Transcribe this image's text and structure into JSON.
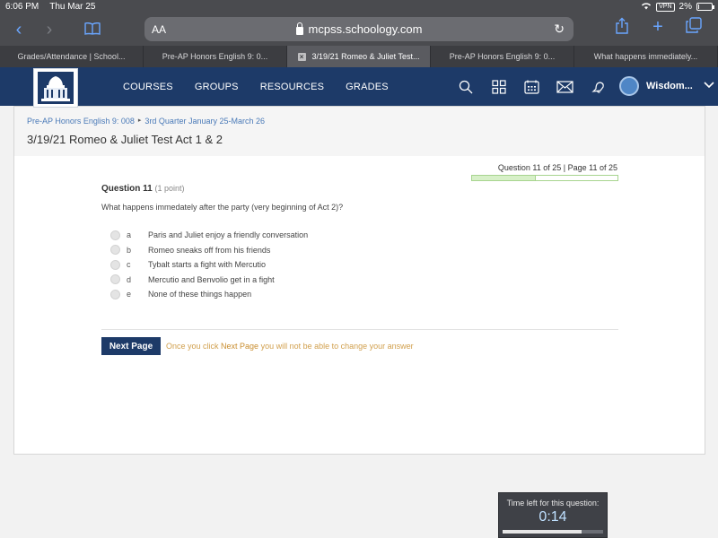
{
  "status": {
    "time": "6:06 PM",
    "date": "Thu Mar 25",
    "vpn": "VPN",
    "battery": "2%",
    "battery_level": 0.02
  },
  "browser": {
    "aa_label": "AA",
    "url": "mcpss.schoology.com",
    "tabs": [
      {
        "label": "Grades/Attendance | School...",
        "active": false
      },
      {
        "label": "Pre-AP Honors English 9: 0...",
        "active": false
      },
      {
        "label": "3/19/21 Romeo & Juliet Test...",
        "active": true
      },
      {
        "label": "Pre-AP Honors English 9: 0...",
        "active": false
      },
      {
        "label": "What happens immediately...",
        "active": false
      }
    ]
  },
  "header": {
    "nav": [
      "COURSES",
      "GROUPS",
      "RESOURCES",
      "GRADES"
    ],
    "user_name": "Wisdom..."
  },
  "breadcrumb": {
    "course": "Pre-AP Honors English 9: 008",
    "separator": "▸",
    "section": "3rd Quarter January 25-March 26"
  },
  "page_title": "3/19/21 Romeo & Juliet Test Act 1 & 2",
  "progress": {
    "label": "Question 11 of 25 | Page 11 of 25",
    "fraction": 0.44
  },
  "question": {
    "title": "Question 11",
    "points": "(1 point)",
    "text": "What happens immedately after the party (very beginning of Act 2)?",
    "choices": [
      {
        "letter": "a",
        "text": "Paris and Juliet enjoy a friendly conversation"
      },
      {
        "letter": "b",
        "text": "Romeo sneaks off from his friends"
      },
      {
        "letter": "c",
        "text": "Tybalt starts a fight with Mercutio"
      },
      {
        "letter": "d",
        "text": "Mercutio and Benvolio get in a fight"
      },
      {
        "letter": "e",
        "text": "None of these things happen"
      }
    ]
  },
  "footer": {
    "next_label": "Next Page",
    "warn_pre": "Once you click ",
    "warn_bold": "Next Page",
    "warn_post": " you will not be able to change your answer"
  },
  "timer": {
    "label": "Time left for this question:",
    "value": "0:14",
    "remaining_fraction": 0.79
  },
  "colors": {
    "brand": "#1d3a68",
    "link": "#4a7ab8",
    "warning": "#d1a04e",
    "progress": "#d7f0c8"
  }
}
